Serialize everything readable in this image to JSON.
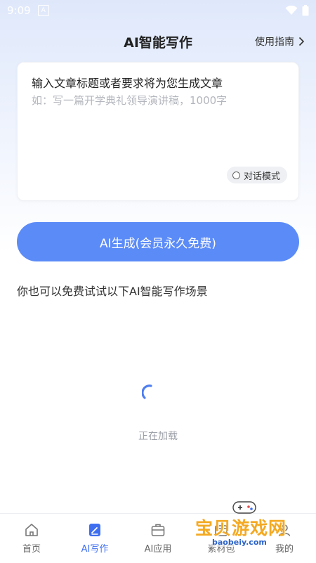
{
  "status_bar": {
    "time": "9:09",
    "notification_icon": "a-badge-icon",
    "signal_icon": "wifi-icon",
    "battery_icon": "battery-icon"
  },
  "header": {
    "title": "AI智能写作",
    "guide_label": "使用指南"
  },
  "input": {
    "value": "输入文章标题或者要求将为您生成文章",
    "placeholder": "如：写一篇开学典礼领导演讲稿，1000字",
    "mode_label": "对话模式"
  },
  "generate_button": {
    "label": "AI生成(会员永久免费)"
  },
  "scene_hint": "你也可以免费试试以下AI智能写作场景",
  "loading": {
    "text": "正在加载"
  },
  "tabs": [
    {
      "label": "首页",
      "icon": "home-icon",
      "active": false
    },
    {
      "label": "AI写作",
      "icon": "ai-write-icon",
      "active": true
    },
    {
      "label": "AI应用",
      "icon": "briefcase-icon",
      "active": false
    },
    {
      "label": "素材包",
      "icon": "package-icon",
      "active": false
    },
    {
      "label": "我的",
      "icon": "profile-icon",
      "active": false
    }
  ],
  "watermark": {
    "text": "宝贝游戏网",
    "url": "baobeiy.com"
  },
  "colors": {
    "accent": "#5b8bf7",
    "active_tab": "#3f6ff0",
    "watermark": "#f4a922"
  }
}
